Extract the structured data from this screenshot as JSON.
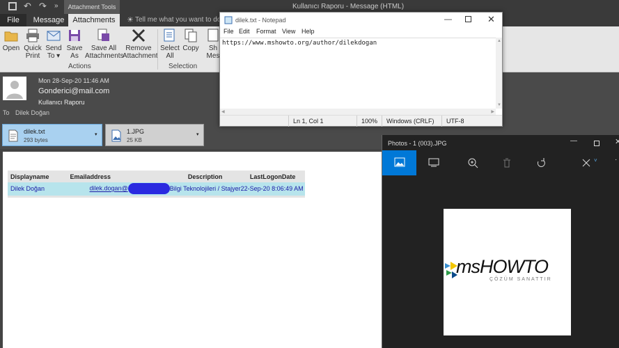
{
  "outlook": {
    "window_title": "Kullanıcı Raporu - Message (HTML)",
    "context_tab": "Attachment Tools",
    "tell_me": "Tell me what you want to do...",
    "tabs": [
      "File",
      "Message",
      "Attachments"
    ],
    "ribbon": {
      "buttons": [
        "Open",
        "Quick Print",
        "Send To",
        "Save As",
        "Save All Attachments",
        "Remove Attachment",
        "Select All",
        "Copy",
        "Sh",
        "Mes"
      ],
      "button_lines": [
        [
          "Open"
        ],
        [
          "Quick",
          "Print"
        ],
        [
          "Send",
          "To ▾"
        ],
        [
          "Save",
          "As"
        ],
        [
          "Save All",
          "Attachments"
        ],
        [
          "Remove",
          "Attachment"
        ],
        [
          "Select",
          "All"
        ],
        [
          "Copy"
        ],
        [
          "Sh"
        ],
        [
          "Mes"
        ]
      ],
      "groups": [
        "Actions",
        "Selection",
        "Mess"
      ]
    },
    "message": {
      "date": "Mon 28-Sep-20 11:46 AM",
      "from": "Gonderici@mail.com",
      "subject": "Kullanıcı Raporu",
      "to_label": "To",
      "to": "Dilek Doğan"
    },
    "attachments": [
      {
        "name": "dilek.txt",
        "size": "293 bytes",
        "icon": "text-file-icon",
        "selected": true
      },
      {
        "name": "1.JPG",
        "size": "25 KB",
        "icon": "image-file-icon",
        "selected": false
      }
    ],
    "table": {
      "headers": [
        "Displayname",
        "Emailaddress",
        "Description",
        "LastLogonDate"
      ],
      "row": {
        "displayname": "Dilek Doğan",
        "email": "dilek.dogan@",
        "description": "Bilgi Teknolojileri / Stajyer",
        "lastlogon": "22-Sep-20 8:06:49 AM"
      }
    }
  },
  "notepad": {
    "title": "dilek.txt - Notepad",
    "menu": [
      "File",
      "Edit",
      "Format",
      "View",
      "Help"
    ],
    "content": "https://www.mshowto.org/author/dilekdogan",
    "status": {
      "position": "Ln 1, Col 1",
      "zoom": "100%",
      "line_ending": "Windows (CRLF)",
      "encoding": "UTF-8"
    }
  },
  "photos": {
    "title": "Photos - 1 (003).JPG",
    "logo_text": "msHOWTO",
    "logo_tagline": "ÇÖZÜM SANATTIR",
    "toolbar_icons": [
      "image-icon",
      "slideshow-icon",
      "zoom-in-icon",
      "delete-icon",
      "rotate-icon",
      "edit-icon"
    ]
  },
  "colors": {
    "accent": "#0078d7",
    "selected_attachment": "#a9d1f0",
    "table_header": "#e4e4e4",
    "table_row": "#b7e4ec",
    "link": "#1a1aa6"
  }
}
